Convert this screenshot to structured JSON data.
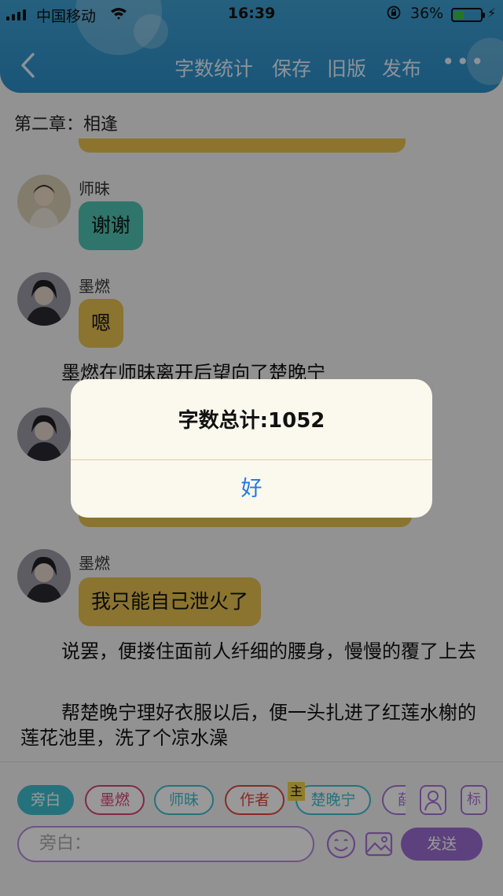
{
  "status_bar": {
    "carrier": "中国移动",
    "time": "16:39",
    "battery_percent": "36%",
    "battery_level": 0.36
  },
  "nav": {
    "word_count_label": "字数统计",
    "save_label": "保存",
    "old_version_label": "旧版",
    "publish_label": "发布",
    "more_label": "•••"
  },
  "chapter_title": "第二章：相逢",
  "messages": [
    {
      "speaker": "师昧",
      "text": "谢谢"
    },
    {
      "speaker": "墨燃",
      "text": "嗯"
    },
    {
      "speaker": "墨燃",
      "text": "我只能自己泄火了"
    }
  ],
  "narrations": [
    "墨燃在师昧离开后望向了楚晚宁",
    "说罢，便搂住面前人纤细的腰身，慢慢的覆了上去",
    "帮楚晚宁理好衣服以后，便一头扎进了红莲水榭的莲花池里，洗了个凉水澡"
  ],
  "alert": {
    "title": "字数总计:1052",
    "ok_label": "好"
  },
  "roles": [
    {
      "label": "旁白",
      "color": "#3fbfcf",
      "selected": true
    },
    {
      "label": "墨燃",
      "color": "#d94476"
    },
    {
      "label": "师昧",
      "color": "#3fbfcf"
    },
    {
      "label": "作者",
      "color": "#e0493c"
    },
    {
      "label": "楚晚宁",
      "color": "#3fbfcf"
    },
    {
      "label": "薛",
      "color": "#a874d6"
    }
  ],
  "main_badge": "主",
  "mark_button": "标",
  "input": {
    "placeholder": "旁白："
  },
  "send_label": "发送",
  "colors": {
    "header": "#2b8ec8",
    "teal_bubble": "#4fc3b3",
    "yellow_bubble": "#e7c24f",
    "send": "#9b6dd2"
  }
}
